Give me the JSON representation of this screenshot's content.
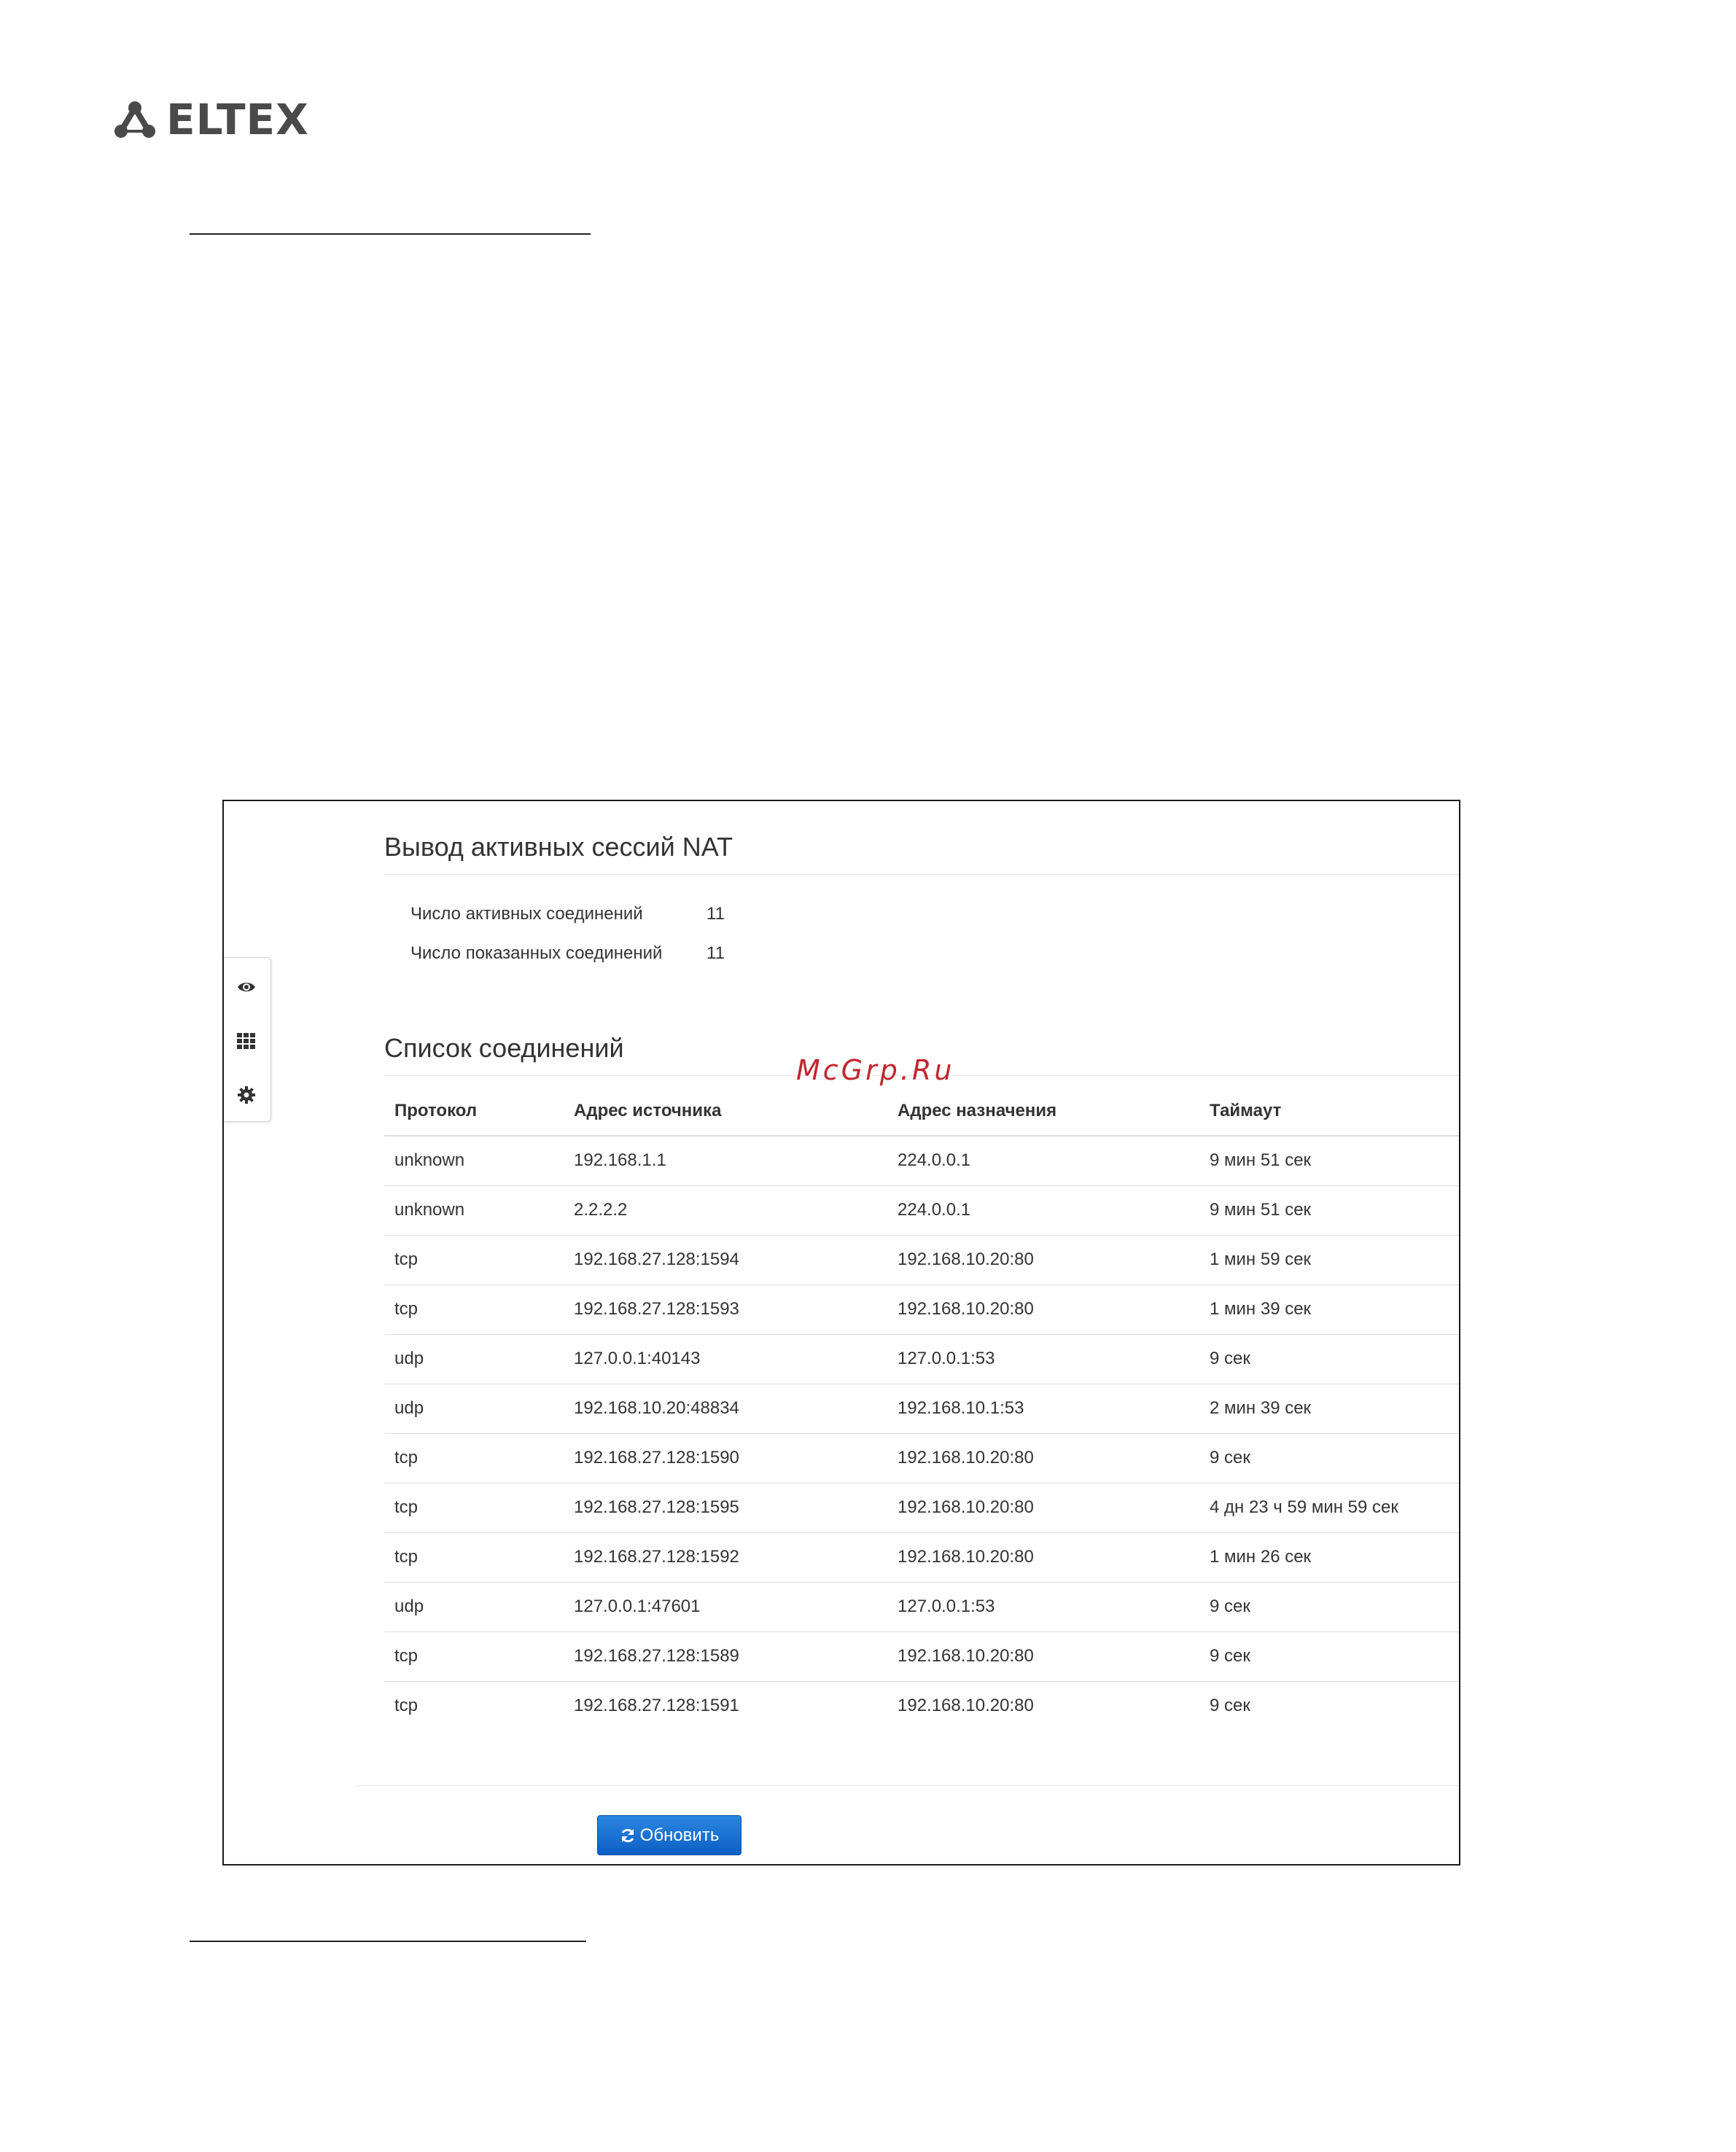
{
  "brand": {
    "logo_text": "ELTEX"
  },
  "watermark": "McGrp.Ru",
  "nat_sessions": {
    "title": "Вывод активных сессий NAT",
    "stats": [
      {
        "label": "Число активных соединений",
        "value": "11"
      },
      {
        "label": "Число показанных соединений",
        "value": "11"
      }
    ]
  },
  "connections": {
    "title": "Список соединений",
    "columns": [
      "Протокол",
      "Адрес источника",
      "Адрес назначения",
      "Таймаут"
    ],
    "rows": [
      [
        "unknown",
        "192.168.1.1",
        "224.0.0.1",
        "9 мин 51 сек"
      ],
      [
        "unknown",
        "2.2.2.2",
        "224.0.0.1",
        "9 мин 51 сек"
      ],
      [
        "tcp",
        "192.168.27.128:1594",
        "192.168.10.20:80",
        "1 мин 59 сек"
      ],
      [
        "tcp",
        "192.168.27.128:1593",
        "192.168.10.20:80",
        "1 мин 39 сек"
      ],
      [
        "udp",
        "127.0.0.1:40143",
        "127.0.0.1:53",
        "9 сек"
      ],
      [
        "udp",
        "192.168.10.20:48834",
        "192.168.10.1:53",
        "2 мин 39 сек"
      ],
      [
        "tcp",
        "192.168.27.128:1590",
        "192.168.10.20:80",
        "9 сек"
      ],
      [
        "tcp",
        "192.168.27.128:1595",
        "192.168.10.20:80",
        "4 дн 23 ч 59 мин 59 сек"
      ],
      [
        "tcp",
        "192.168.27.128:1592",
        "192.168.10.20:80",
        "1 мин 26 сек"
      ],
      [
        "udp",
        "127.0.0.1:47601",
        "127.0.0.1:53",
        "9 сек"
      ],
      [
        "tcp",
        "192.168.27.128:1589",
        "192.168.10.20:80",
        "9 сек"
      ],
      [
        "tcp",
        "192.168.27.128:1591",
        "192.168.10.20:80",
        "9 сек"
      ]
    ]
  },
  "actions": {
    "refresh_label": "Обновить"
  },
  "sidebar": {
    "icons": [
      "eye-icon",
      "grid-icon",
      "gear-icon"
    ]
  },
  "colors": {
    "button_primary": "#1a73d4",
    "watermark": "#c0262d",
    "text": "#333333"
  }
}
